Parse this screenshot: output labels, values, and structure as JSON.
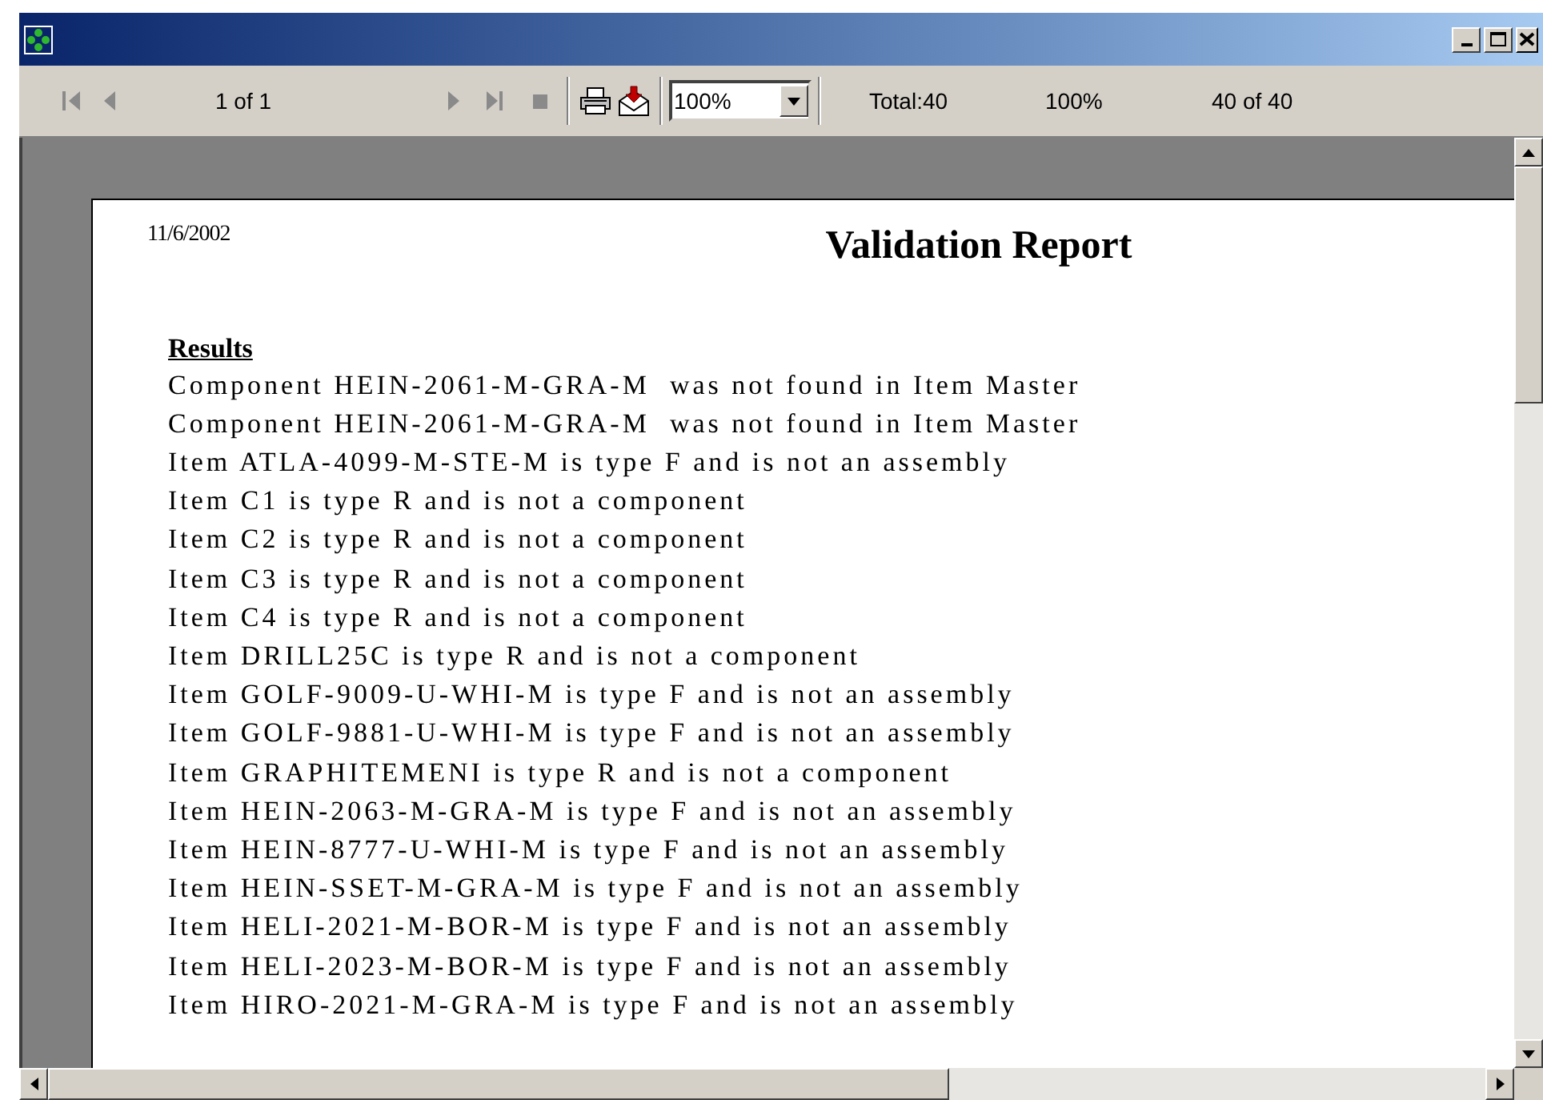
{
  "toolbar": {
    "nav_buttons": [
      {
        "kind": "first",
        "disabled": true
      },
      {
        "kind": "prev",
        "disabled": true
      },
      {
        "kind": "next",
        "disabled": true
      },
      {
        "kind": "last",
        "disabled": true
      },
      {
        "kind": "stop",
        "disabled": true
      }
    ],
    "page_indicator": "1 of 1",
    "zoom": {
      "value": "100%"
    },
    "total": "Total:40",
    "percent": "100%",
    "record_count": "40 of 40"
  },
  "report": {
    "date": "11/6/2002",
    "title": "Validation Report",
    "section_heading": "Results",
    "lines": [
      "Component HEIN-2061-M-GRA-M  was not found in Item Master",
      "Component HEIN-2061-M-GRA-M  was not found in Item Master",
      "Item ATLA-4099-M-STE-M is type F and is not an assembly",
      "Item C1 is type R and is not a component",
      "Item C2 is type R and is not a component",
      "Item C3 is type R and is not a component",
      "Item C4 is type R and is not a component",
      "Item DRILL25C is type R and is not a component",
      "Item GOLF-9009-U-WHI-M is type F and is not an assembly",
      "Item GOLF-9881-U-WHI-M is type F and is not an assembly",
      "Item GRAPHITEMENI is type R and is not a component",
      "Item HEIN-2063-M-GRA-M is type F and is not an assembly",
      "Item HEIN-8777-U-WHI-M is type F and is not an assembly",
      "Item HEIN-SSET-M-GRA-M is type F and is not an assembly",
      "Item HELI-2021-M-BOR-M is type F and is not an assembly",
      "Item HELI-2023-M-BOR-M is type F and is not an assembly",
      "Item HIRO-2021-M-GRA-M is type F and is not an assembly"
    ]
  }
}
